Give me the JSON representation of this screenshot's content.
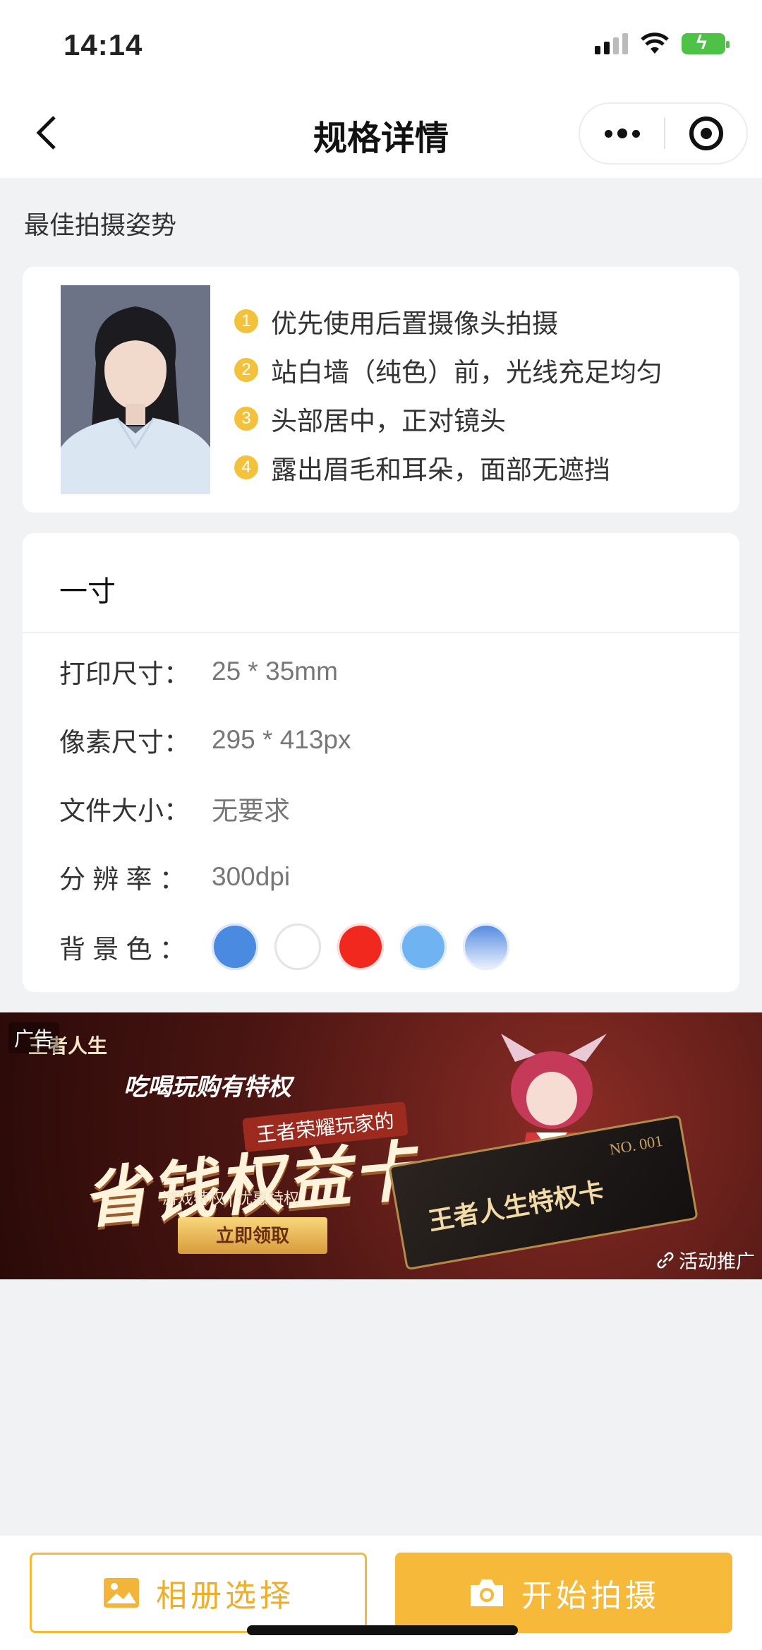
{
  "status_bar": {
    "time": "14:14"
  },
  "nav": {
    "title": "规格详情"
  },
  "pose": {
    "section_title": "最佳拍摄姿势",
    "tips": [
      {
        "num": "1",
        "text": "优先使用后置摄像头拍摄"
      },
      {
        "num": "2",
        "text": "站白墙（纯色）前，光线充足均匀"
      },
      {
        "num": "3",
        "text": "头部居中，正对镜头"
      },
      {
        "num": "4",
        "text": "露出眉毛和耳朵，面部无遮挡"
      }
    ]
  },
  "spec": {
    "title": "一寸",
    "rows": [
      {
        "label": "打印尺寸：",
        "value": "25 * 35mm"
      },
      {
        "label": "像素尺寸：",
        "value": "295 * 413px"
      },
      {
        "label": "文件大小：",
        "value": "无要求"
      },
      {
        "label": "分 辨 率 ：",
        "value": "300dpi"
      }
    ],
    "bg_label": "背 景 色 ：",
    "bg_colors": [
      "#4a8ae0",
      "#ffffff",
      "#f0281e",
      "#6fb3f2",
      "#5d93e6"
    ]
  },
  "ad": {
    "tag": "广告",
    "brand": "王者人生",
    "subtitle": "吃喝玩购有特权",
    "subtitle2": "王者荣耀玩家的",
    "headline": "省钱权益卡",
    "perks": "游戏特权 | 优惠特权",
    "cta": "立即领取",
    "card_title": "王者人生特权卡",
    "card_no": "NO. 001",
    "promo": "活动推广"
  },
  "bottom": {
    "album_label": "相册选择",
    "shoot_label": "开始拍摄"
  }
}
